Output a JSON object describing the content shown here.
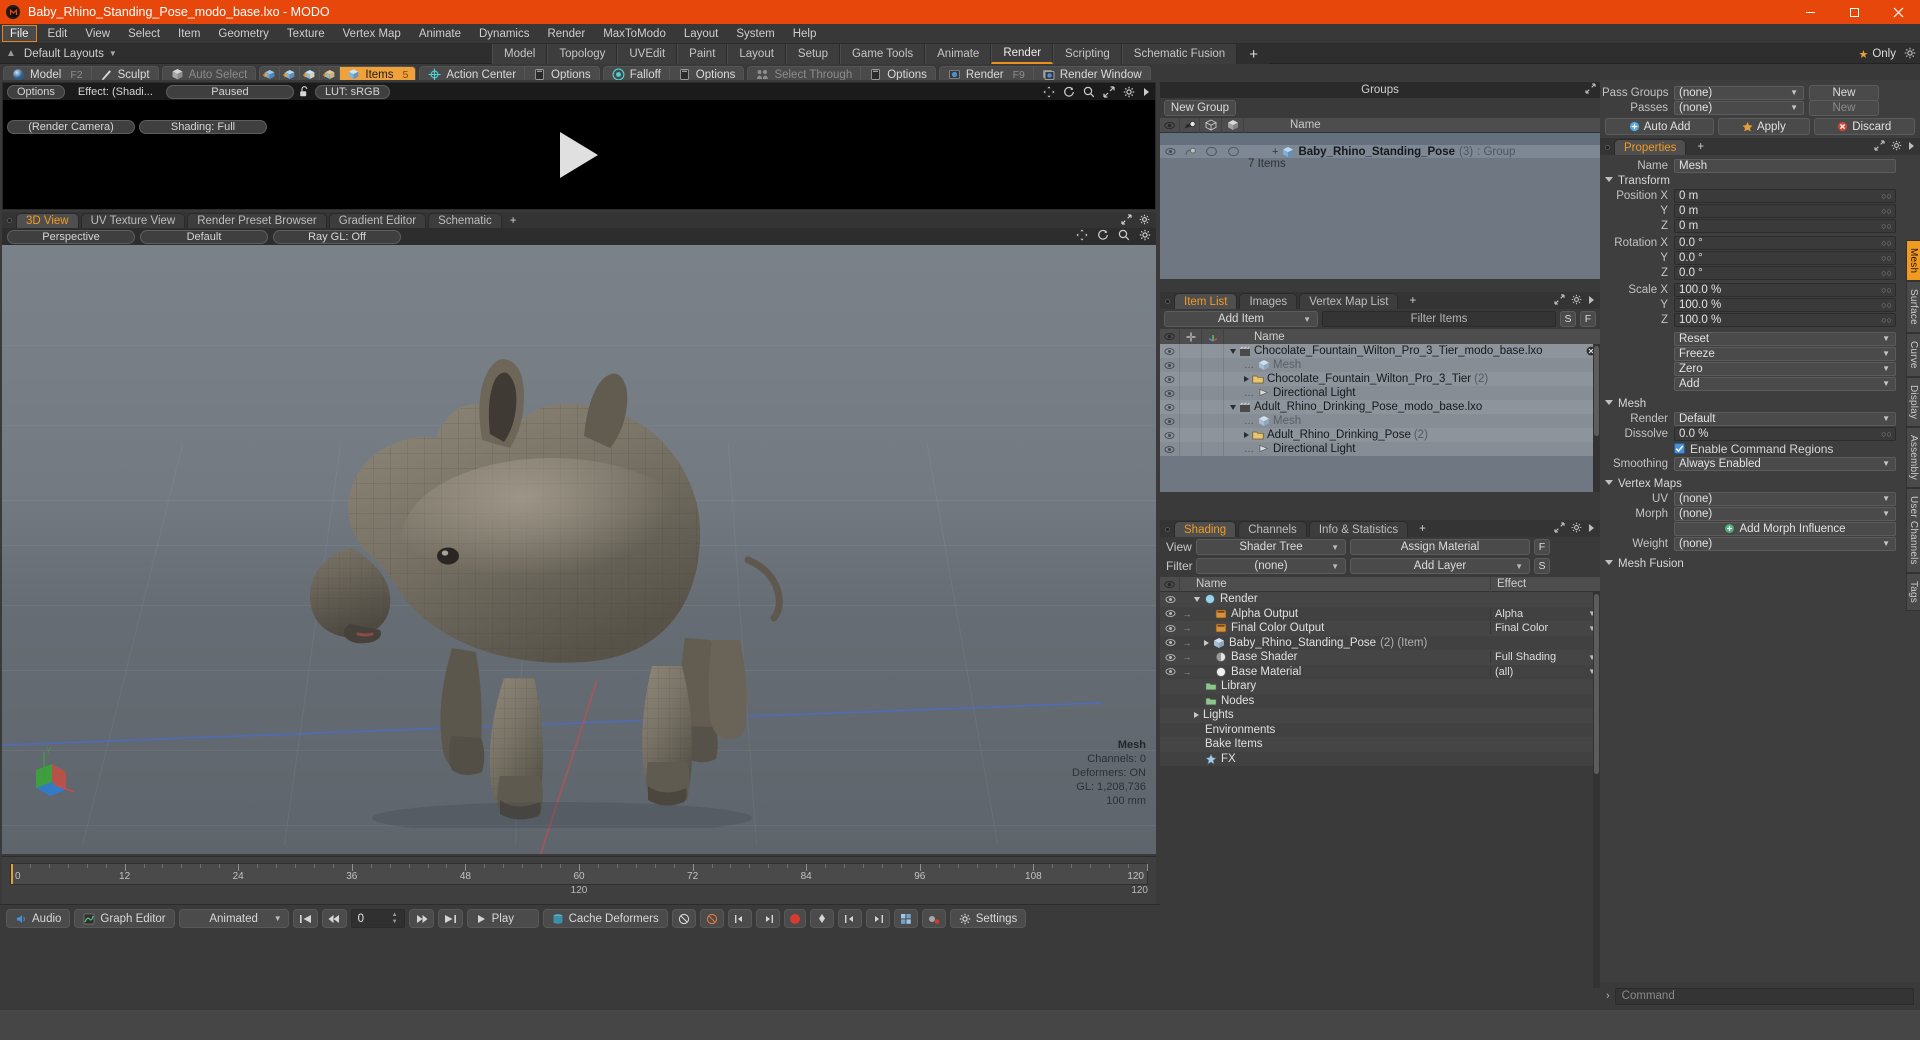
{
  "window": {
    "title": "Baby_Rhino_Standing_Pose_modo_base.lxo - MODO",
    "minimize": "–",
    "maximize": "❐",
    "close": "✕"
  },
  "menubar": {
    "items": [
      "File",
      "Edit",
      "View",
      "Select",
      "Item",
      "Geometry",
      "Texture",
      "Vertex Map",
      "Animate",
      "Dynamics",
      "Render",
      "MaxToModo",
      "Layout",
      "System",
      "Help"
    ],
    "active": "File"
  },
  "layoutbar": {
    "default_layouts": "Default Layouts",
    "tabs": [
      "Model",
      "Topology",
      "UVEdit",
      "Paint",
      "Layout",
      "Setup",
      "Game Tools",
      "Animate",
      "Render",
      "Scripting",
      "Schematic Fusion"
    ],
    "selected": "Render",
    "plus": "+",
    "only_label": "Only"
  },
  "maintoolbar": {
    "model": "Model",
    "model_key": "F2",
    "sculpt": "Sculpt",
    "auto_select": "Auto Select",
    "items": "Items",
    "items_key": "5",
    "action_center": "Action Center",
    "options1": "Options",
    "falloff": "Falloff",
    "options2": "Options",
    "select_through": "Select Through",
    "options3": "Options",
    "render": "Render",
    "render_key": "F9",
    "render_window": "Render Window"
  },
  "preview": {
    "options": "Options",
    "effect": "Effect: (Shadi...",
    "paused": "Paused",
    "lut": "LUT: sRGB",
    "render_camera": "(Render Camera)",
    "shading": "Shading: Full"
  },
  "viewtabs": {
    "tabs": [
      "3D View",
      "UV Texture View",
      "Render Preset Browser",
      "Gradient Editor",
      "Schematic"
    ],
    "selected": "3D View",
    "plus": "+"
  },
  "viewport": {
    "perspective": "Perspective",
    "default": "Default",
    "raygl": "Ray GL: Off",
    "info": {
      "mesh": "Mesh",
      "channels": "Channels: 0",
      "deformers": "Deformers: ON",
      "gl": "GL: 1,208,736",
      "scale": "100 mm"
    }
  },
  "timeline": {
    "ticks": [
      0,
      12,
      24,
      36,
      48,
      60,
      72,
      84,
      96,
      108,
      120
    ],
    "range_start": 0,
    "range_end": 120,
    "center_label": "120",
    "right_label": "120"
  },
  "bottombar": {
    "audio": "Audio",
    "graph_editor": "Graph Editor",
    "animated": "Animated",
    "frame_value": "0",
    "play": "Play",
    "cache_deformers": "Cache Deformers",
    "settings": "Settings"
  },
  "groups": {
    "title": "Groups",
    "new_group": "New Group",
    "columns": [
      "eye",
      "shade",
      "cube-a",
      "cube-b",
      "Name"
    ],
    "rows": [
      {
        "name": "Baby_Rhino_Standing_Pose",
        "count": "(3)",
        "type": ": Group",
        "sub": "7 Items"
      }
    ]
  },
  "itemlist": {
    "tabs": [
      "Item List",
      "Images",
      "Vertex Map List"
    ],
    "selected": "Item List",
    "plus": "+",
    "add_item": "Add Item",
    "filter_placeholder": "Filter Items",
    "s_button": "S",
    "f_button": "F",
    "columns": [
      "eye",
      "lock",
      "axis",
      "Name"
    ],
    "rows": [
      {
        "name": "Chocolate_Fountain_Wilton_Pro_3_Tier_modo_base.lxo",
        "icon": "scene-icon",
        "indent": 0,
        "expanded": true,
        "close": true
      },
      {
        "name": "Mesh",
        "icon": "mesh-icon",
        "indent": 1,
        "dim": true
      },
      {
        "name": "Chocolate_Fountain_Wilton_Pro_3_Tier",
        "suffix": "(2)",
        "icon": "group-icon",
        "indent": 1,
        "collapsed": true
      },
      {
        "name": "Directional Light",
        "icon": "light-icon",
        "indent": 1
      },
      {
        "name": "Adult_Rhino_Drinking_Pose_modo_base.lxo",
        "icon": "scene-icon",
        "indent": 0,
        "expanded": true
      },
      {
        "name": "Mesh",
        "icon": "mesh-icon",
        "indent": 1,
        "dim": true
      },
      {
        "name": "Adult_Rhino_Drinking_Pose",
        "suffix": "(2)",
        "icon": "group-icon",
        "indent": 1,
        "collapsed": true
      },
      {
        "name": "Directional Light",
        "icon": "light-icon",
        "indent": 1
      }
    ]
  },
  "shading": {
    "tabs": [
      "Shading",
      "Channels",
      "Info & Statistics"
    ],
    "selected": "Shading",
    "plus": "+",
    "view_label": "View",
    "view_value": "Shader Tree",
    "assign_material": "Assign Material",
    "f_button": "F",
    "filter_label": "Filter",
    "filter_value": "(none)",
    "add_layer": "Add Layer",
    "s_button": "S",
    "col_name": "Name",
    "col_effect": "Effect",
    "rows": [
      {
        "name": "Render",
        "effect": "",
        "indent": 0,
        "expanded": true,
        "icon": "render-icon"
      },
      {
        "name": "Alpha Output",
        "effect": "Alpha",
        "indent": 1,
        "icon": "output-icon"
      },
      {
        "name": "Final Color Output",
        "effect": "Final Color",
        "indent": 1,
        "icon": "output-icon"
      },
      {
        "name": "Baby_Rhino_Standing_Pose",
        "suffix": "(2) (Item)",
        "effect": "",
        "indent": 1,
        "collapsed": true,
        "icon": "item-icon"
      },
      {
        "name": "Base Shader",
        "effect": "Full Shading",
        "indent": 1,
        "icon": "shader-icon"
      },
      {
        "name": "Base Material",
        "effect": "(all)",
        "indent": 1,
        "icon": "material-icon"
      },
      {
        "name": "Library",
        "effect": "",
        "indent": 0,
        "icon": "folder-icon"
      },
      {
        "name": "Nodes",
        "effect": "",
        "indent": 0,
        "icon": "folder-icon"
      },
      {
        "name": "Lights",
        "effect": "",
        "indent": 0,
        "collapsed": true,
        "icon": "none"
      },
      {
        "name": "Environments",
        "effect": "",
        "indent": 0,
        "icon": "none"
      },
      {
        "name": "Bake Items",
        "effect": "",
        "indent": 0,
        "icon": "none"
      },
      {
        "name": "FX",
        "effect": "",
        "indent": 0,
        "icon": "fx-icon"
      }
    ]
  },
  "properties": {
    "pass_groups_label": "Pass Groups",
    "pass_groups_value": "(none)",
    "passes_label": "Passes",
    "passes_value": "(none)",
    "new_button": "New",
    "new_button2": "New",
    "auto_add": "Auto Add",
    "apply": "Apply",
    "discard": "Discard",
    "tab": "Properties",
    "tab_plus": "+",
    "name_label": "Name",
    "name_value": "Mesh",
    "transform_section": "Transform",
    "position": {
      "label": "Position X",
      "x": "0 m",
      "y": "0 m",
      "z": "0 m"
    },
    "rotation": {
      "label": "Rotation X",
      "x": "0.0 °",
      "y": "0.0 °",
      "z": "0.0 °"
    },
    "scale": {
      "label": "Scale X",
      "x": "100.0 %",
      "y": "100.0 %",
      "z": "100.0 %"
    },
    "axis_y": "Y",
    "axis_z": "Z",
    "reset": "Reset",
    "freeze": "Freeze",
    "zero": "Zero",
    "add": "Add",
    "mesh_section": "Mesh",
    "render_label": "Render",
    "render_value": "Default",
    "dissolve_label": "Dissolve",
    "dissolve_value": "0.0 %",
    "enable_command_regions": "Enable Command Regions",
    "smoothing_label": "Smoothing",
    "smoothing_value": "Always Enabled",
    "vertex_maps_section": "Vertex Maps",
    "uv_label": "UV",
    "uv_value": "(none)",
    "morph_label": "Morph",
    "morph_value": "(none)",
    "add_morph_influence": "Add Morph Influence",
    "weight_label": "Weight",
    "weight_value": "(none)",
    "mesh_fusion_section": "Mesh Fusion"
  },
  "verticaltabs": [
    "Mesh",
    "Surface",
    "Curve",
    "Display",
    "Assembly",
    "User Channels",
    "Tags"
  ],
  "verticaltab_selected": "Mesh",
  "command": {
    "placeholder": "Command",
    "arrow": "›"
  },
  "colors": {
    "title_bar": "#e8470c",
    "accent_orange": "#f09a22",
    "panel_bg": "#3a3a3a",
    "list_bg": "#6e7782",
    "viewport_bg": "#6e757c"
  }
}
